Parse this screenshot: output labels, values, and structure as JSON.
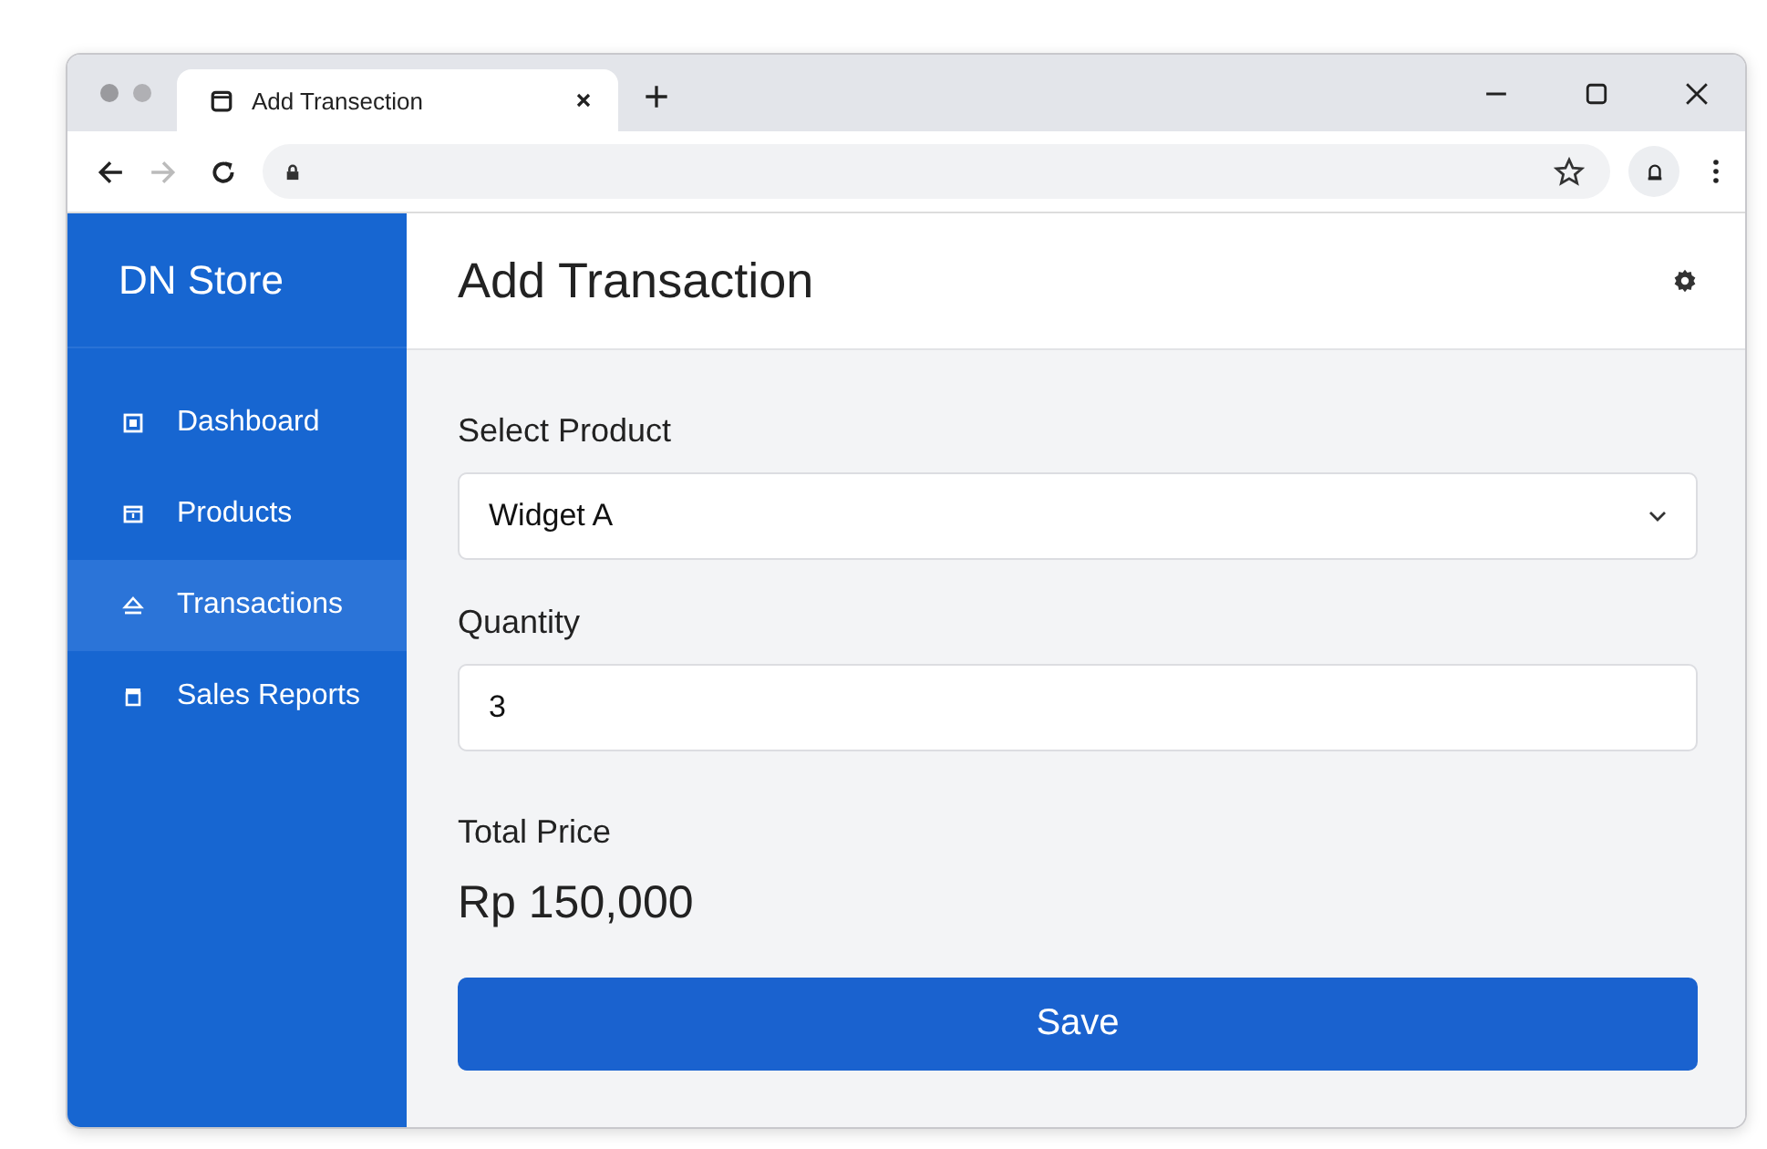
{
  "browser": {
    "tab": {
      "title": "Add Transection"
    }
  },
  "sidebar": {
    "brand": "DN Store",
    "items": [
      {
        "label": "Dashboard",
        "selected": false,
        "kind": "dashboard"
      },
      {
        "label": "Products",
        "selected": false,
        "kind": "products"
      },
      {
        "label": "Transactions",
        "selected": true,
        "kind": "transactions"
      },
      {
        "label": "Sales Reports",
        "selected": false,
        "kind": "reports"
      }
    ]
  },
  "header": {
    "title": "Add Transaction"
  },
  "form": {
    "product": {
      "label": "Select Product",
      "value": "Widget A"
    },
    "quantity": {
      "label": "Quantity",
      "value": "3"
    },
    "total": {
      "label": "Total Price",
      "value": "Rp 150,000"
    },
    "save": "Save"
  }
}
